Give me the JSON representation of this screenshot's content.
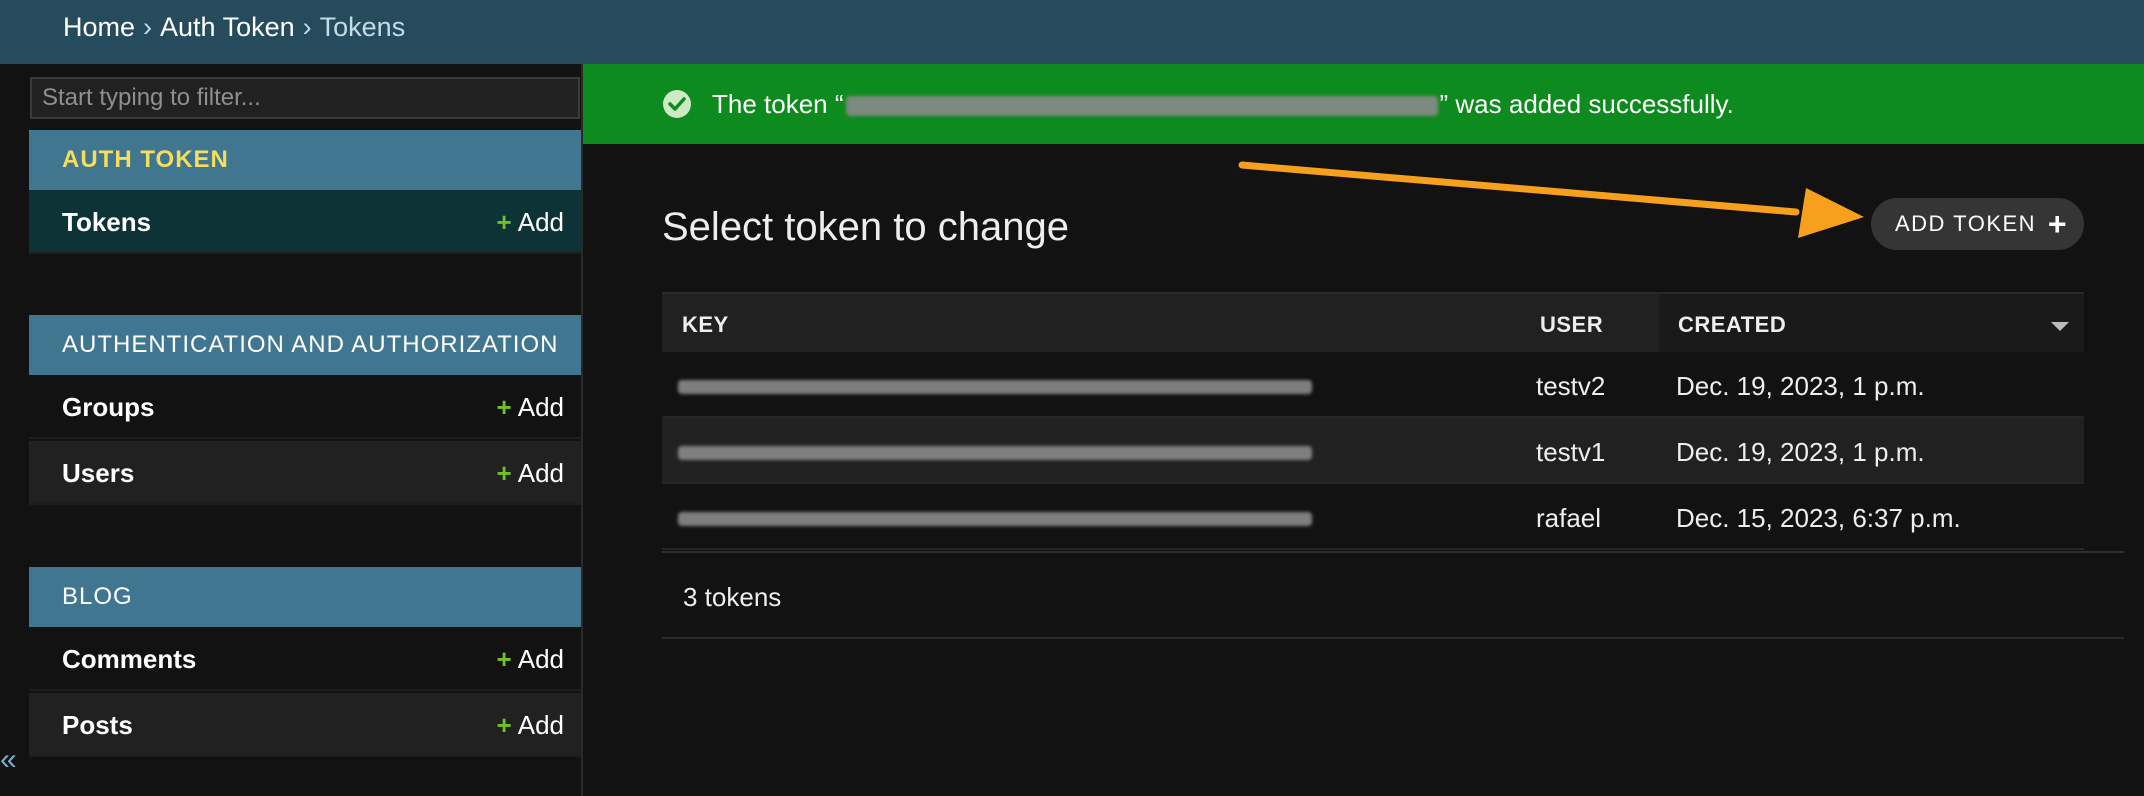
{
  "breadcrumbs": {
    "home": "Home",
    "separator": "›",
    "app": "Auth Token",
    "current": "Tokens"
  },
  "sidebar": {
    "filter_placeholder": "Start typing to filter...",
    "collapse_icon": "«",
    "add_label": "Add",
    "add_icon": "+",
    "modules": [
      {
        "caption": "AUTH TOKEN",
        "models": [
          {
            "name": "Tokens"
          }
        ]
      },
      {
        "caption": "AUTHENTICATION AND AUTHORIZATION",
        "models": [
          {
            "name": "Groups"
          },
          {
            "name": "Users"
          }
        ]
      },
      {
        "caption": "BLOG",
        "models": [
          {
            "name": "Comments"
          },
          {
            "name": "Posts"
          }
        ]
      }
    ]
  },
  "messages": {
    "success_prefix": "The token “",
    "success_suffix": "” was added successfully.",
    "success_icon": "check-circle-icon"
  },
  "content": {
    "title": "Select token to change",
    "add_button_label": "ADD TOKEN",
    "add_button_icon": "+"
  },
  "table": {
    "columns": [
      "KEY",
      "USER",
      "CREATED"
    ],
    "sorted_column": "CREATED",
    "rows": [
      {
        "user": "testv2",
        "created": "Dec. 19, 2023, 1 p.m."
      },
      {
        "user": "testv1",
        "created": "Dec. 19, 2023, 1 p.m."
      },
      {
        "user": "rafael",
        "created": "Dec. 15, 2023, 6:37 p.m."
      }
    ]
  },
  "paginator": {
    "count_text": "3 tokens"
  },
  "colors": {
    "header": "#264b5d",
    "module_caption": "#417690",
    "success": "#0e8b1e",
    "add_plus": "#70bf2b",
    "annotation_arrow": "#f7a01d"
  }
}
